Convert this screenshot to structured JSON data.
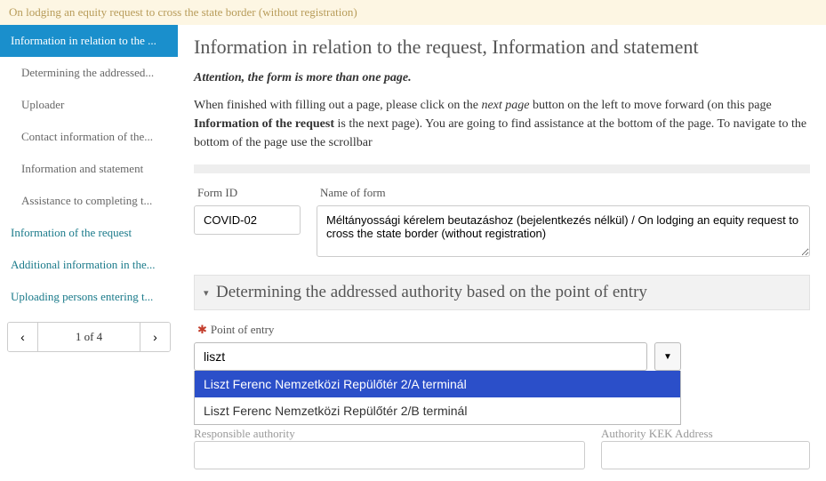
{
  "banner": "On lodging an equity request to cross the state border (without registration)",
  "sidebar": {
    "items": [
      "Information in relation to the ...",
      "Determining the addressed...",
      "Uploader",
      "Contact information of the...",
      "Information and statement",
      "Assistance to completing t...",
      "Information of the request",
      "Additional information in the...",
      "Uploading persons entering t..."
    ]
  },
  "pager": {
    "label": "1 of 4",
    "prev": "‹",
    "next": "›"
  },
  "heading": "Information in relation to the request, Information and statement",
  "attention": "Attention, the form is more than one page.",
  "instr": {
    "p1a": "When finished with filling out a page, please click on the ",
    "np": "next page",
    "p1b": " button on the left to move forward (on this page ",
    "bold": "Information of the request",
    "p1c": " is the next page). You are going to find assistance at the bottom of the page. To navigate to the bottom of the page use the scrollbar"
  },
  "form": {
    "id_label": "Form ID",
    "id_value": "COVID-02",
    "name_label": "Name of form",
    "name_value": "Méltányossági kérelem beutazáshoz (bejelentkezés nélkül) / On lodging an equity request to cross the state border (without registration)"
  },
  "section": {
    "title": "Determining the addressed authority based on the point of entry",
    "point_label": "Point of entry",
    "point_value": "liszt",
    "options": [
      "Liszt Ferenc Nemzetközi Repülőtér 2/A terminál",
      "Liszt Ferenc Nemzetközi Repülőtér 2/B terminál"
    ],
    "resp_label": "Responsible authority",
    "kek_label": "Authority KEK Address"
  }
}
